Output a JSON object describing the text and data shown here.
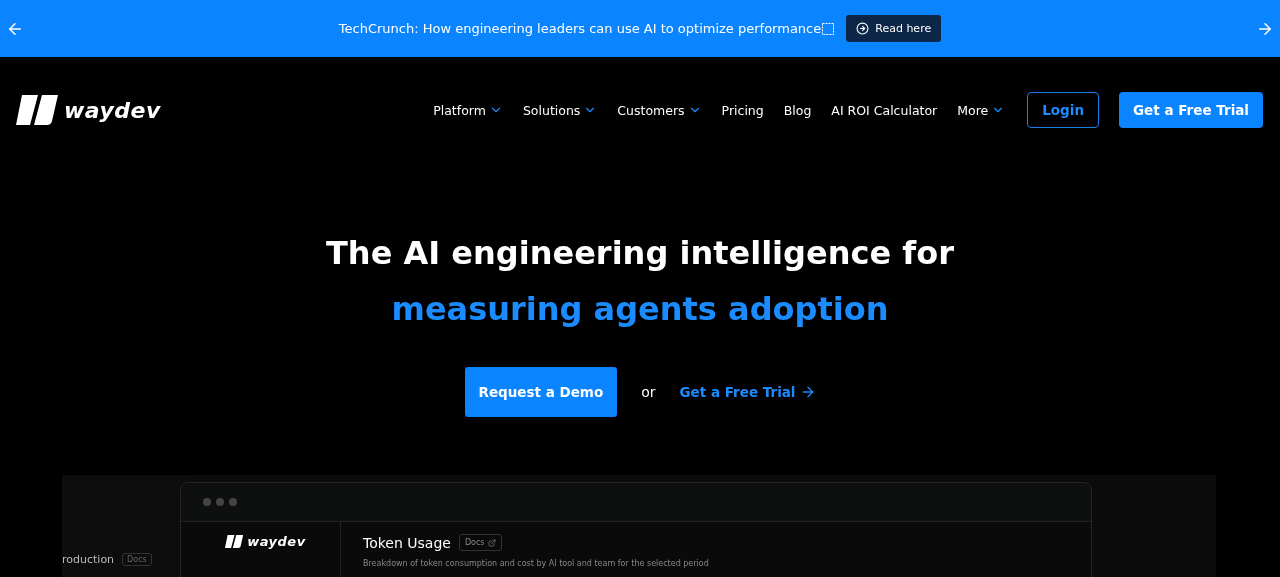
{
  "banner": {
    "text": "TechCrunch: How engineering leaders can use AI to optimize performance",
    "button": "Read here"
  },
  "nav": {
    "logo": "waydev",
    "items": [
      {
        "label": "Platform",
        "dropdown": true
      },
      {
        "label": "Solutions",
        "dropdown": true
      },
      {
        "label": "Customers",
        "dropdown": true
      },
      {
        "label": "Pricing",
        "dropdown": false
      },
      {
        "label": "Blog",
        "dropdown": false
      },
      {
        "label": "AI ROI Calculator",
        "dropdown": false
      },
      {
        "label": "More",
        "dropdown": true
      }
    ],
    "login": "Login",
    "cta": "Get a Free Trial"
  },
  "hero": {
    "title": "The AI engineering intelligence for",
    "highlight": "measuring agents adoption",
    "primary": "Request a Demo",
    "or": "or",
    "secondary": "Get a Free Trial"
  },
  "preview": {
    "back_title": "roduction",
    "back_docs": "Docs",
    "logo": "waydev",
    "title": "Token Usage",
    "docs": "Docs",
    "description": "Breakdown of token consumption and cost by AI tool and team for the selected period"
  }
}
